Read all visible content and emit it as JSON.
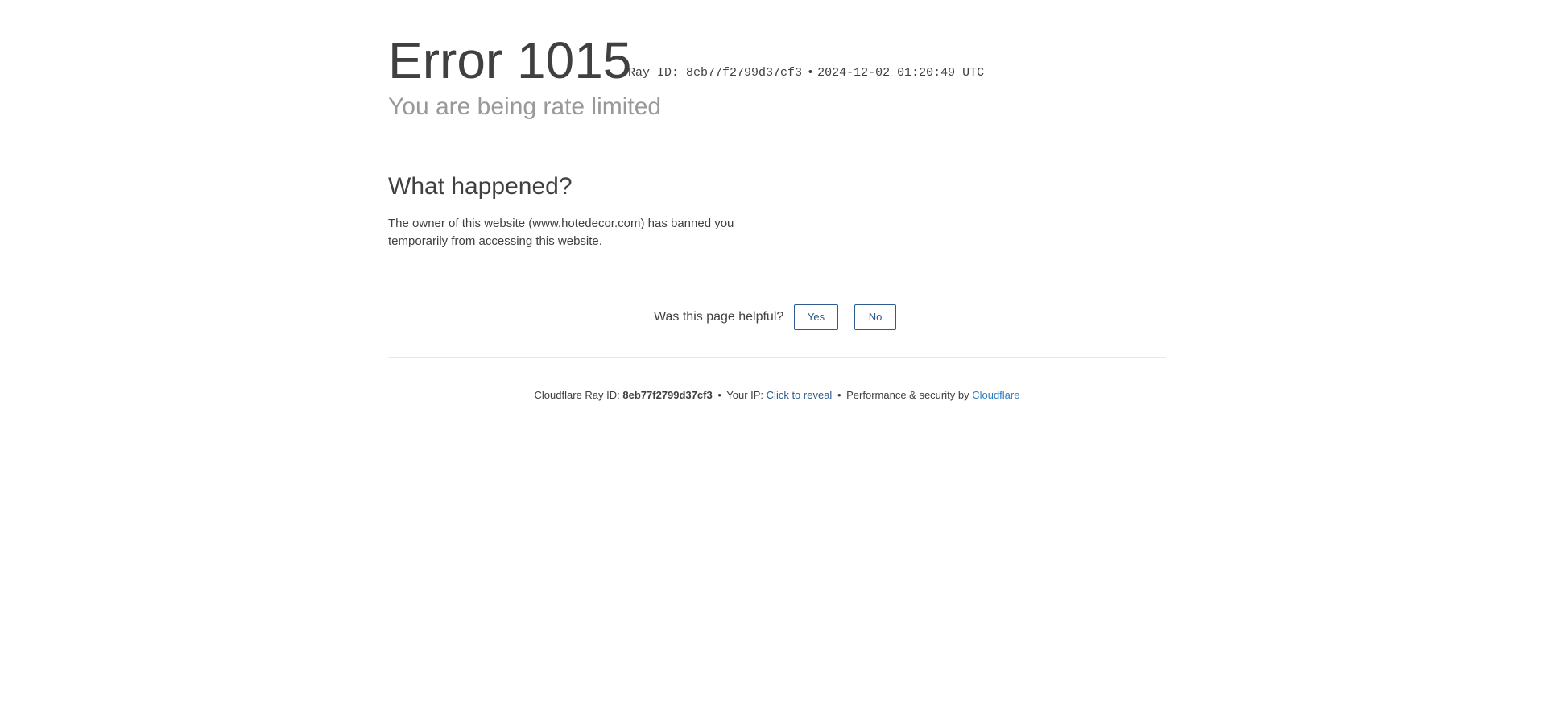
{
  "header": {
    "error_code": "Error 1015",
    "ray_id_label": "Ray ID: 8eb77f2799d37cf3",
    "separator": "•",
    "timestamp": "2024-12-02 01:20:49 UTC",
    "subtitle": "You are being rate limited"
  },
  "what_happened": {
    "title": "What happened?",
    "body": "The owner of this website (www.hotedecor.com) has banned you temporarily from accessing this website."
  },
  "feedback": {
    "question": "Was this page helpful?",
    "yes_label": "Yes",
    "no_label": "No"
  },
  "footer": {
    "ray_label": "Cloudflare Ray ID:",
    "ray_value": "8eb77f2799d37cf3",
    "bullet": "•",
    "ip_label": "Your IP:",
    "ip_link": "Click to reveal",
    "perf_label": "Performance & security by",
    "cf_link": "Cloudflare"
  },
  "colors": {
    "text": "#404040",
    "muted": "#999999",
    "button_border": "#2f5a8e",
    "link": "#2f5a8e",
    "cloudflare_link": "#2f7bbf"
  }
}
